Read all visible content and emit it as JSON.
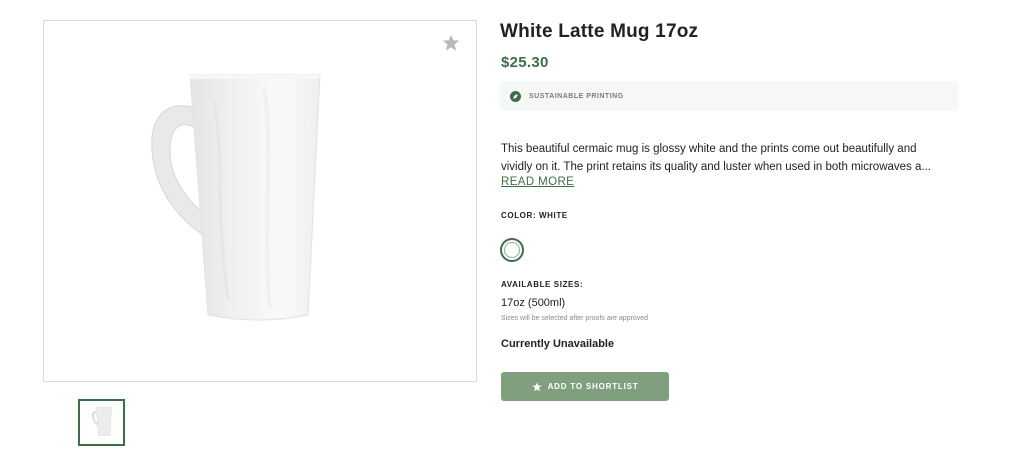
{
  "product": {
    "title": "White Latte Mug 17oz",
    "price": "$25.30",
    "badge": "SUSTAINABLE PRINTING",
    "description_lines": [
      "This beautiful cermaic mug is glossy white and the prints come out beautifully and",
      "vividly on it. The print retains its quality and luster when used in both microwaves a..."
    ],
    "read_more": "READ MORE",
    "color_label": "COLOR: WHITE",
    "sizes_label": "AVAILABLE SIZES:",
    "size_value": "17oz (500ml)",
    "size_note": "Sizes will be selected after proofs are approved",
    "availability": "Currently Unavailable",
    "shortlist_button": "ADD TO SHORTLIST"
  },
  "icons": {
    "favorite": "star-icon",
    "badge": "leaf-icon",
    "button": "star-icon"
  },
  "colors": {
    "accent": "#3c6e47",
    "button": "#7f9f7e",
    "badge_bg": "#f6f8f6"
  }
}
